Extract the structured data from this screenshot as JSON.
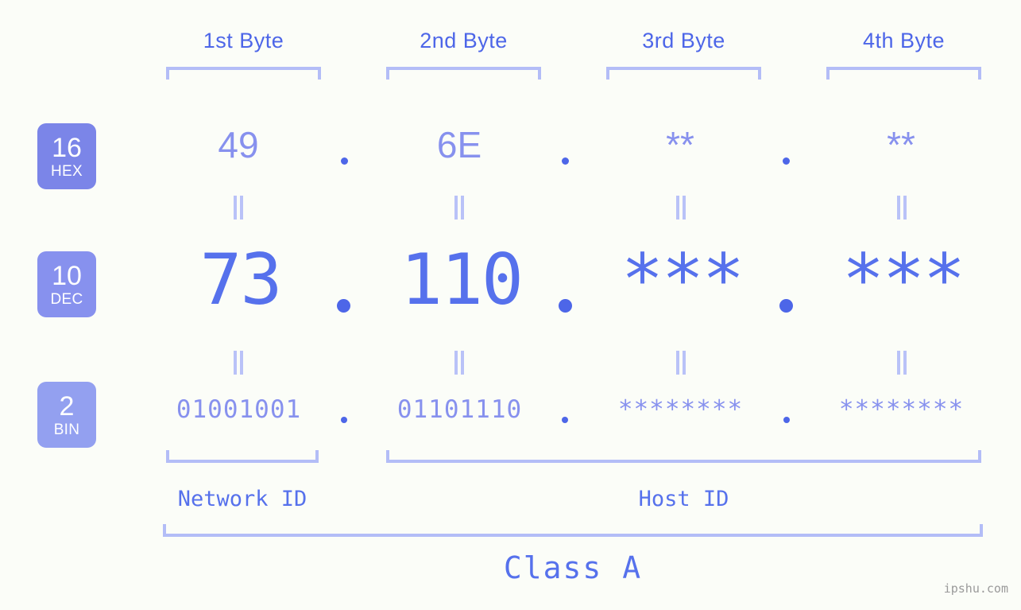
{
  "meta": {
    "background_color": "#fbfdf8",
    "accent_color": "#5671ec",
    "accent_light_color": "#8791ee",
    "bracket_color": "#b3bdf7",
    "watermark": "ipshu.com"
  },
  "headers": [
    {
      "label": "1st Byte"
    },
    {
      "label": "2nd Byte"
    },
    {
      "label": "3rd Byte"
    },
    {
      "label": "4th Byte"
    }
  ],
  "bases": [
    {
      "number": "16",
      "abbr": "HEX",
      "color": "#7b85e8"
    },
    {
      "number": "10",
      "abbr": "DEC",
      "color": "#8791ee"
    },
    {
      "number": "2",
      "abbr": "BIN",
      "color": "#93a0f0"
    }
  ],
  "rows": {
    "hex": {
      "values": [
        "49",
        "6E",
        "**",
        "**"
      ]
    },
    "dec": {
      "values": [
        "73",
        "110",
        "***",
        "***"
      ]
    },
    "bin": {
      "values": [
        "01001001",
        "01101110",
        "********",
        "********"
      ]
    }
  },
  "separator": ".",
  "equals_marker": "=",
  "sections": [
    {
      "label": "Network ID"
    },
    {
      "label": "Host ID"
    }
  ],
  "class": {
    "label": "Class A"
  }
}
